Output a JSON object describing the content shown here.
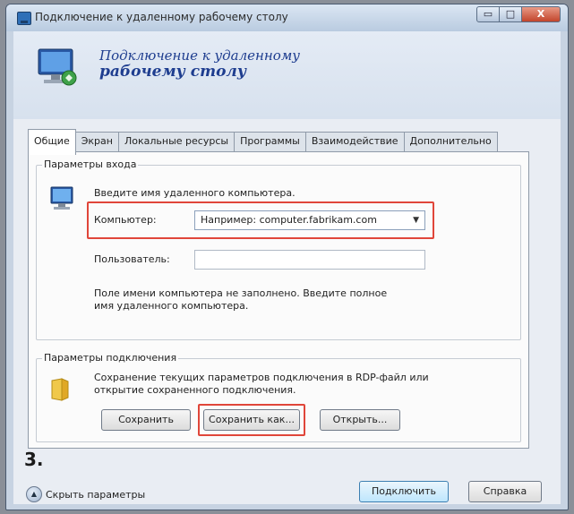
{
  "window": {
    "title": "Подключение к удаленному рабочему столу",
    "controls": {
      "minimize": "▭",
      "maximize": "□",
      "close": "X"
    }
  },
  "banner": {
    "title_line1": "Подключение к удаленному",
    "title_line2": "рабочему столу"
  },
  "tabs": [
    {
      "label": "Общие",
      "active": true
    },
    {
      "label": "Экран"
    },
    {
      "label": "Локальные ресурсы"
    },
    {
      "label": "Программы"
    },
    {
      "label": "Взаимодействие"
    },
    {
      "label": "Дополнительно"
    }
  ],
  "login_group": {
    "title": "Параметры входа",
    "prompt": "Введите имя удаленного компьютера.",
    "computer_label": "Компьютер:",
    "computer_value": "Например: computer.fabrikam.com",
    "user_label": "Пользователь:",
    "user_value": "",
    "hint_line1": "Поле имени компьютера не заполнено. Введите полное",
    "hint_line2": "имя удаленного компьютера."
  },
  "connection_group": {
    "title": "Параметры подключения",
    "desc_line1": "Сохранение текущих параметров подключения в RDP-файл или",
    "desc_line2": "открытие сохраненного подключения.",
    "save": "Сохранить",
    "save_as": "Сохранить как...",
    "open": "Открыть..."
  },
  "step_marker": "3.",
  "footer": {
    "hide_options": "Скрыть параметры",
    "connect": "Подключить",
    "help": "Справка"
  },
  "colors": {
    "highlight": "#e0463a",
    "banner_title": "#1e3d8f"
  }
}
